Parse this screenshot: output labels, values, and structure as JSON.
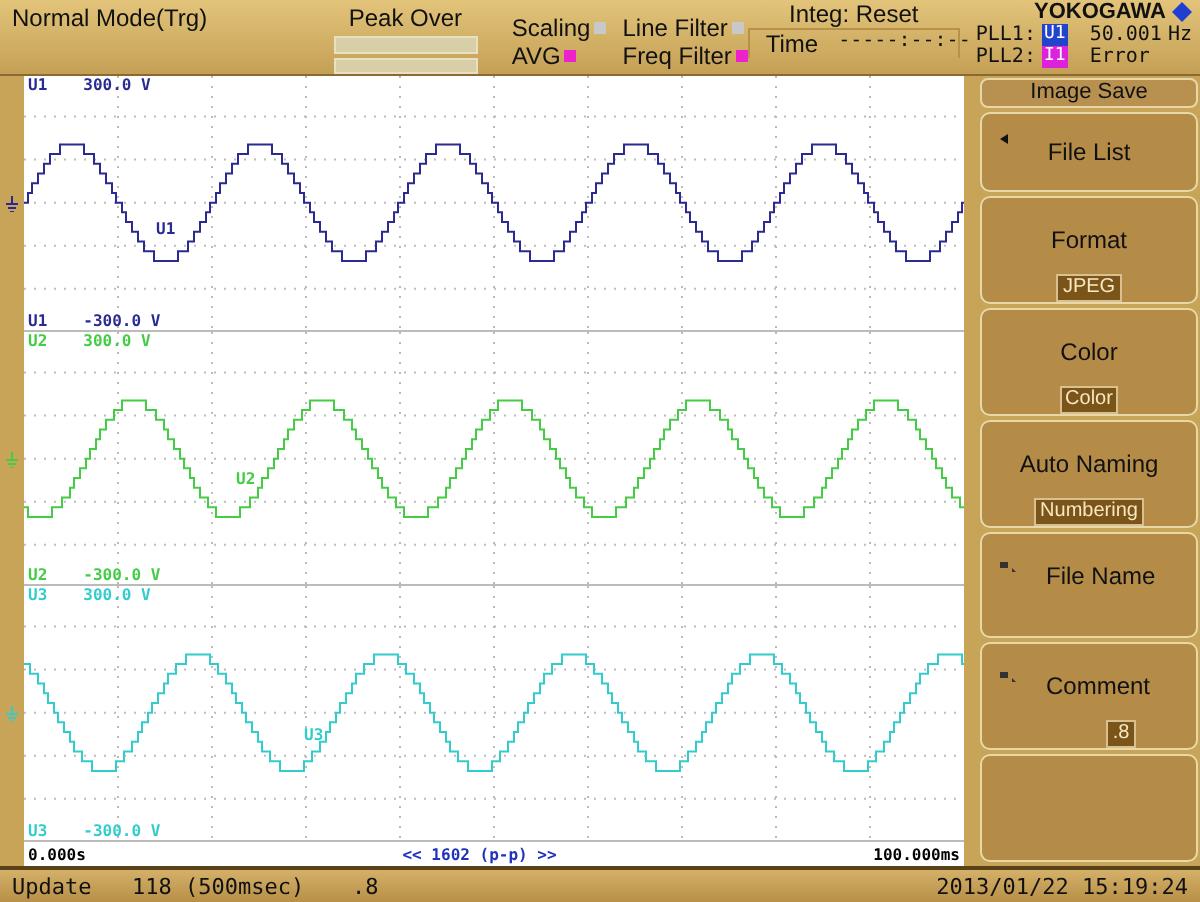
{
  "header": {
    "mode": "Normal Mode(Trg)",
    "peak_over": "Peak Over",
    "indicators": [
      {
        "label": "Scaling",
        "on": false
      },
      {
        "label": "AVG",
        "on": true
      },
      {
        "label": "Line Filter",
        "on": false
      },
      {
        "label": "Freq Filter",
        "on": true
      }
    ],
    "integ": "Integ: Reset",
    "time_label": "Time",
    "time_value": "-----:--:--",
    "brand": "YOKOGAWA",
    "pll": [
      {
        "label": "PLL1:",
        "source": "U1",
        "color": "#2244cc",
        "reading": "50.001",
        "unit": "Hz"
      },
      {
        "label": "PLL2:",
        "source": "I1",
        "color": "#dd22dd",
        "reading": "Error"
      }
    ]
  },
  "channels": [
    {
      "color": "#2a2a90",
      "top_label": {
        "name": "U1",
        "value": "300.0 V"
      },
      "bottom_label": {
        "name": "U1",
        "value": "-300.0 V"
      },
      "trace_label": "U1"
    },
    {
      "color": "#44cc44",
      "top_label": {
        "name": "U2",
        "value": "300.0 V"
      },
      "bottom_label": {
        "name": "U2",
        "value": "-300.0 V"
      },
      "trace_label": "U2"
    },
    {
      "color": "#33cccc",
      "top_label": {
        "name": "U3",
        "value": "300.0 V"
      },
      "bottom_label": {
        "name": "U3",
        "value": "-300.0 V"
      },
      "trace_label": "U3"
    }
  ],
  "time_axis": {
    "start": "0.000s",
    "center": "<< 1602 (p-p) >>",
    "end": "100.000ms"
  },
  "menu": {
    "title": "Image Save",
    "items": [
      {
        "kind": "action",
        "label": "File List"
      },
      {
        "kind": "option",
        "label": "Format",
        "value": "JPEG"
      },
      {
        "kind": "option",
        "label": "Color",
        "value": "Color"
      },
      {
        "kind": "option",
        "label": "Auto Naming",
        "value": "Numbering"
      },
      {
        "kind": "input",
        "label": "File Name"
      },
      {
        "kind": "input",
        "label": "Comment",
        "value": ".8"
      },
      {
        "kind": "blank"
      }
    ]
  },
  "status_bar": {
    "update_label": "Update",
    "update_count": "118 (500msec)",
    "comment": ".8",
    "datetime": "2013/01/22 15:19:24"
  }
}
